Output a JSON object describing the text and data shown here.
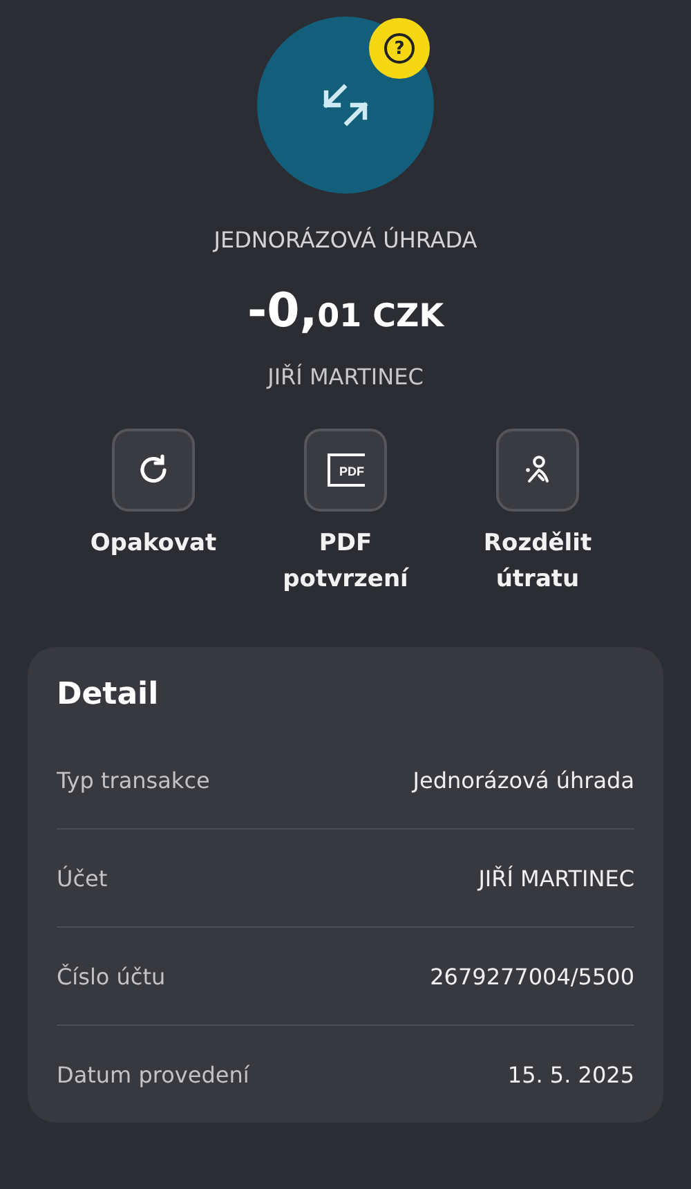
{
  "header": {
    "badge": "?",
    "title": "JEDNORÁZOVÁ ÚHRADA",
    "amount_main": "-0,",
    "amount_minor": "01 CZK",
    "counterparty": "JIŘÍ MARTINEC"
  },
  "actions": [
    {
      "kind": "repeat",
      "label": "Opakovat"
    },
    {
      "kind": "pdf",
      "icon_text": "PDF",
      "label": "PDF potvrzení"
    },
    {
      "kind": "split",
      "label": "Rozdělit útratu"
    }
  ],
  "detail": {
    "title": "Detail",
    "rows": [
      {
        "label": "Typ transakce",
        "value": "Jednorázová úhrada"
      },
      {
        "label": "Účet",
        "value": "JIŘÍ MARTINEC"
      },
      {
        "label": "Číslo účtu",
        "value": "2679277004/5500"
      },
      {
        "label": "Datum provedení",
        "value": "15. 5. 2025"
      }
    ]
  }
}
